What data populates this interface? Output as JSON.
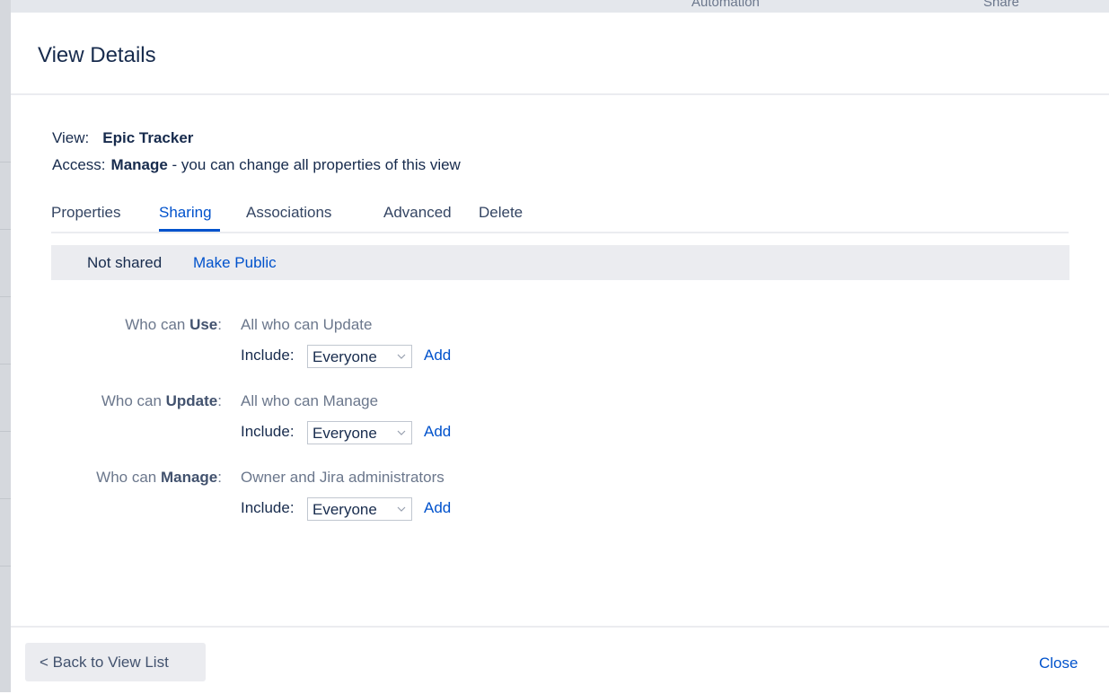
{
  "dialog": {
    "title": "View Details"
  },
  "meta": {
    "view_label": "View:",
    "view_name": "Epic Tracker",
    "access_label": "Access:",
    "access_level": "Manage",
    "access_desc": " - you can change all properties of this view"
  },
  "tabs": [
    {
      "label": "Properties",
      "active": false
    },
    {
      "label": "Sharing",
      "active": true
    },
    {
      "label": "Associations",
      "active": false
    },
    {
      "label": "Advanced",
      "active": false
    },
    {
      "label": "Delete",
      "active": false
    }
  ],
  "sharing": {
    "status": "Not shared",
    "make_public": "Make Public",
    "permissions": [
      {
        "prefix": "Who can ",
        "keyword": "Use",
        "suffix": ":",
        "value": "All who can Update",
        "include_label": "Include:",
        "include_selected": "Everyone",
        "add_label": "Add"
      },
      {
        "prefix": "Who can ",
        "keyword": "Update",
        "suffix": ":",
        "value": "All who can Manage",
        "include_label": "Include:",
        "include_selected": "Everyone",
        "add_label": "Add"
      },
      {
        "prefix": "Who can ",
        "keyword": "Manage",
        "suffix": ":",
        "value": "Owner and Jira administrators",
        "include_label": "Include:",
        "include_selected": "Everyone",
        "add_label": "Add"
      }
    ]
  },
  "footer": {
    "back_label": "< Back to View List",
    "close_label": "Close"
  },
  "background": {
    "partial_toolbar_text": "Automation",
    "partial_share_text": "Share"
  },
  "colors": {
    "accent": "#0052cc",
    "text": "#172b4d",
    "muted": "#6b778c",
    "bar_bg": "#ebecf0"
  }
}
